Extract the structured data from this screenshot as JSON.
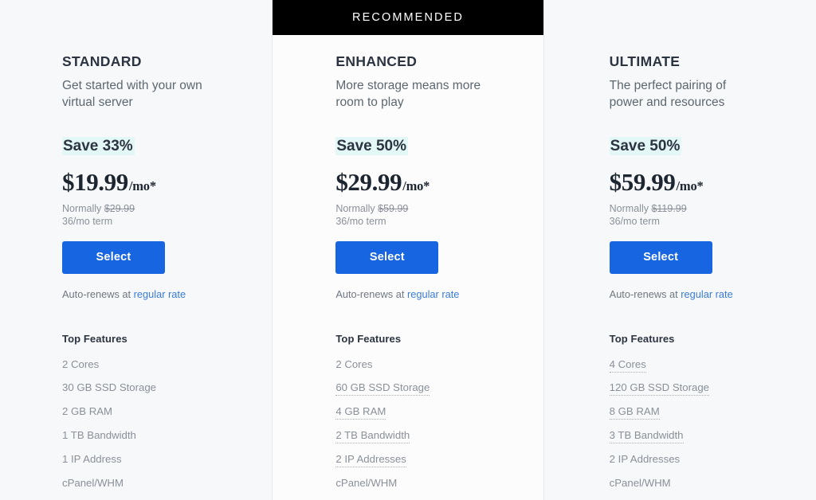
{
  "colors": {
    "page_background": "#f7f8f9",
    "featured_background": "#fcfcfd",
    "banner_background": "#000000",
    "banner_text": "#ffffff",
    "button_blue": "#1765e0",
    "link_blue": "#3a7bd5",
    "save_highlight": "#e3f7f6",
    "heading_text": "#2b3440",
    "muted_text": "#8a9099",
    "divider": "#e9e9ec"
  },
  "banner": {
    "label": "RECOMMENDED"
  },
  "common": {
    "features_title": "Top Features",
    "select_label": "Select",
    "renew_prefix": "Auto-renews at ",
    "renew_link": "regular rate",
    "term": "36/mo term",
    "normally_prefix": "Normally ",
    "price_suffix": "/mo*"
  },
  "plans": [
    {
      "id": "standard",
      "name": "STANDARD",
      "tagline": "Get started with your own virtual server",
      "save_label": "Save 33%",
      "price": "$19.99",
      "price_suffix": "/mo*",
      "normally_prefix": "Normally ",
      "normally_price": "$29.99",
      "term": "36/mo term",
      "select_label": "Select",
      "renew_prefix": "Auto-renews at ",
      "renew_link": "regular rate",
      "features_title": "Top Features",
      "recommended": false,
      "features": [
        {
          "label": "2 Cores",
          "highlight": false
        },
        {
          "label": "30 GB SSD Storage",
          "highlight": false
        },
        {
          "label": "2 GB RAM",
          "highlight": false
        },
        {
          "label": "1 TB Bandwidth",
          "highlight": false
        },
        {
          "label": "1 IP Address",
          "highlight": false
        },
        {
          "label": "cPanel/WHM",
          "highlight": false
        }
      ]
    },
    {
      "id": "enhanced",
      "name": "ENHANCED",
      "tagline": "More storage means more room to play",
      "save_label": "Save 50%",
      "price": "$29.99",
      "price_suffix": "/mo*",
      "normally_prefix": "Normally ",
      "normally_price": "$59.99",
      "term": "36/mo term",
      "select_label": "Select",
      "renew_prefix": "Auto-renews at ",
      "renew_link": "regular rate",
      "features_title": "Top Features",
      "recommended": true,
      "features": [
        {
          "label": "2 Cores",
          "highlight": false
        },
        {
          "label": "60 GB SSD Storage",
          "highlight": true
        },
        {
          "label": "4 GB RAM",
          "highlight": true
        },
        {
          "label": "2 TB Bandwidth",
          "highlight": true
        },
        {
          "label": "2 IP Addresses",
          "highlight": true
        },
        {
          "label": "cPanel/WHM",
          "highlight": false
        }
      ]
    },
    {
      "id": "ultimate",
      "name": "ULTIMATE",
      "tagline": "The perfect pairing of power and resources",
      "save_label": "Save 50%",
      "price": "$59.99",
      "price_suffix": "/mo*",
      "normally_prefix": "Normally ",
      "normally_price": "$119.99",
      "term": "36/mo term",
      "select_label": "Select",
      "renew_prefix": "Auto-renews at ",
      "renew_link": "regular rate",
      "features_title": "Top Features",
      "recommended": false,
      "features": [
        {
          "label": "4 Cores",
          "highlight": true
        },
        {
          "label": "120 GB SSD Storage",
          "highlight": true
        },
        {
          "label": "8 GB RAM",
          "highlight": true
        },
        {
          "label": "3 TB Bandwidth",
          "highlight": true
        },
        {
          "label": "2 IP Addresses",
          "highlight": false
        },
        {
          "label": "cPanel/WHM",
          "highlight": false
        }
      ]
    }
  ]
}
